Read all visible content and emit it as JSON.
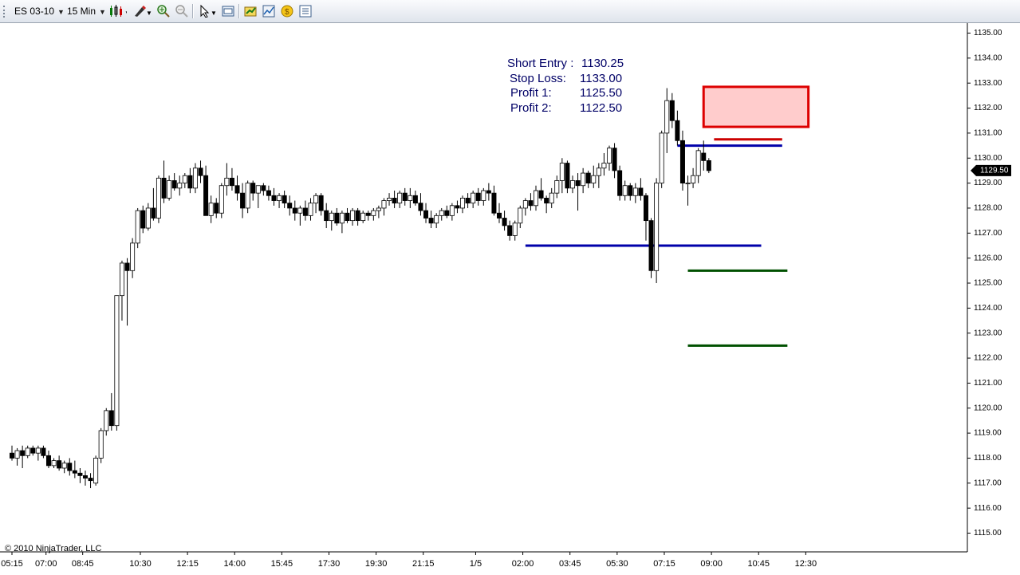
{
  "toolbar": {
    "instrument": "ES 03-10",
    "interval": "15 Min",
    "icons": [
      "bar-type-icon",
      "drawing-tool-icon",
      "zoom-in-icon",
      "zoom-out-icon",
      "pointer-icon",
      "data-box-icon",
      "strategy-icon",
      "indicator-icon",
      "alert-icon",
      "properties-icon"
    ]
  },
  "colors": {
    "entry_line": "#0000aa",
    "stop_line": "#cc0000",
    "target_line": "#005000",
    "stop_zone_fill": "#ffcccc",
    "stop_zone_border": "#dd0000",
    "text": "#000066"
  },
  "annotation": {
    "lines": [
      {
        "label": "Short Entry :",
        "value": "1130.25"
      },
      {
        "label": "Stop Loss:",
        "value": "1133.00"
      },
      {
        "label": "Profit 1:",
        "value": "1125.50"
      },
      {
        "label": "Profit 2:",
        "value": "1122.50"
      }
    ]
  },
  "copyright": "© 2010 NinjaTrader, LLC",
  "chart_data": {
    "type": "candlestick",
    "instrument": "ES 03-10",
    "interval": "15 Min",
    "ylim": [
      1114.5,
      1135.5
    ],
    "y_ticks": [
      "1115.00",
      "1116.00",
      "1117.00",
      "1118.00",
      "1119.00",
      "1120.00",
      "1121.00",
      "1122.00",
      "1123.00",
      "1124.00",
      "1125.00",
      "1126.00",
      "1127.00",
      "1128.00",
      "1129.00",
      "1130.00",
      "1131.00",
      "1132.00",
      "1133.00",
      "1134.00",
      "1135.00"
    ],
    "x_tick_labels": [
      "05:15",
      "07:00",
      "08:45",
      "10:30",
      "12:15",
      "14:00",
      "15:45",
      "17:30",
      "19:30",
      "21:15",
      "1/5",
      "02:00",
      "03:45",
      "05:30",
      "07:15",
      "09:00",
      "10:45",
      "12:30"
    ],
    "last_price_label": "1129.50",
    "last_price": 1129.5,
    "candles": [
      [
        1118.2,
        1118.5,
        1117.9,
        1118.0
      ],
      [
        1118.0,
        1118.4,
        1117.7,
        1118.3
      ],
      [
        1118.3,
        1118.5,
        1117.6,
        1118.1
      ],
      [
        1118.1,
        1118.5,
        1118.0,
        1118.4
      ],
      [
        1118.4,
        1118.5,
        1118.1,
        1118.2
      ],
      [
        1118.2,
        1118.5,
        1117.9,
        1118.4
      ],
      [
        1118.4,
        1118.5,
        1118.0,
        1118.1
      ],
      [
        1118.1,
        1118.3,
        1117.6,
        1117.7
      ],
      [
        1117.7,
        1118.0,
        1117.6,
        1117.9
      ],
      [
        1117.9,
        1118.1,
        1117.5,
        1117.6
      ],
      [
        1117.6,
        1117.9,
        1117.4,
        1117.8
      ],
      [
        1117.8,
        1118.0,
        1117.3,
        1117.5
      ],
      [
        1117.5,
        1117.9,
        1117.2,
        1117.4
      ],
      [
        1117.4,
        1117.6,
        1117.0,
        1117.3
      ],
      [
        1117.3,
        1117.5,
        1116.9,
        1117.2
      ],
      [
        1117.2,
        1117.4,
        1116.8,
        1117.1
      ],
      [
        1117.0,
        1118.1,
        1116.9,
        1118.0
      ],
      [
        1118.0,
        1119.2,
        1117.8,
        1119.1
      ],
      [
        1119.1,
        1120.0,
        1118.9,
        1119.9
      ],
      [
        1119.9,
        1120.6,
        1119.1,
        1119.3
      ],
      [
        1119.3,
        1124.5,
        1119.1,
        1124.5
      ],
      [
        1124.5,
        1125.9,
        1123.5,
        1125.8
      ],
      [
        1125.8,
        1126.0,
        1123.3,
        1125.5
      ],
      [
        1125.5,
        1126.8,
        1125.2,
        1126.6
      ],
      [
        1126.6,
        1128.0,
        1126.4,
        1127.9
      ],
      [
        1127.9,
        1128.1,
        1127.0,
        1127.2
      ],
      [
        1127.2,
        1128.2,
        1127.1,
        1128.0
      ],
      [
        1128.0,
        1128.8,
        1127.5,
        1127.6
      ],
      [
        1127.6,
        1129.3,
        1127.4,
        1129.2
      ],
      [
        1129.2,
        1129.9,
        1128.2,
        1128.4
      ],
      [
        1128.4,
        1129.3,
        1128.3,
        1129.1
      ],
      [
        1129.1,
        1129.4,
        1128.7,
        1128.8
      ],
      [
        1128.8,
        1129.3,
        1128.5,
        1129.0
      ],
      [
        1129.0,
        1129.4,
        1128.8,
        1129.3
      ],
      [
        1129.3,
        1129.6,
        1128.6,
        1128.8
      ],
      [
        1128.8,
        1129.8,
        1128.6,
        1129.6
      ],
      [
        1129.6,
        1129.9,
        1129.0,
        1129.3
      ],
      [
        1129.3,
        1129.7,
        1127.8,
        1127.7
      ],
      [
        1127.7,
        1128.5,
        1127.4,
        1128.2
      ],
      [
        1128.2,
        1128.4,
        1127.6,
        1127.8
      ],
      [
        1127.8,
        1129.0,
        1127.6,
        1128.9
      ],
      [
        1128.9,
        1129.8,
        1128.5,
        1129.2
      ],
      [
        1129.2,
        1129.6,
        1128.7,
        1128.9
      ],
      [
        1128.9,
        1129.3,
        1128.3,
        1128.6
      ],
      [
        1128.6,
        1129.0,
        1127.6,
        1128.0
      ],
      [
        1128.0,
        1129.1,
        1127.8,
        1129.0
      ],
      [
        1129.0,
        1129.1,
        1128.3,
        1128.6
      ],
      [
        1128.6,
        1128.9,
        1128.0,
        1128.9
      ],
      [
        1128.9,
        1129.0,
        1128.5,
        1128.7
      ],
      [
        1128.7,
        1128.9,
        1128.3,
        1128.5
      ],
      [
        1128.5,
        1128.8,
        1128.1,
        1128.3
      ],
      [
        1128.3,
        1128.6,
        1128.0,
        1128.5
      ],
      [
        1128.5,
        1128.7,
        1128.0,
        1128.2
      ],
      [
        1128.2,
        1128.5,
        1127.7,
        1128.0
      ],
      [
        1128.0,
        1128.3,
        1127.5,
        1127.8
      ],
      [
        1127.8,
        1128.1,
        1127.3,
        1128.0
      ],
      [
        1128.0,
        1128.3,
        1127.5,
        1127.7
      ],
      [
        1127.7,
        1128.4,
        1127.5,
        1128.2
      ],
      [
        1128.2,
        1128.6,
        1127.8,
        1128.5
      ],
      [
        1128.5,
        1128.6,
        1127.7,
        1127.9
      ],
      [
        1127.9,
        1128.2,
        1127.2,
        1127.5
      ],
      [
        1127.5,
        1127.9,
        1127.1,
        1127.8
      ],
      [
        1127.8,
        1128.0,
        1127.3,
        1127.4
      ],
      [
        1127.4,
        1127.9,
        1127.0,
        1127.8
      ],
      [
        1127.8,
        1128.0,
        1127.4,
        1127.5
      ],
      [
        1127.5,
        1128.0,
        1127.3,
        1127.9
      ],
      [
        1127.9,
        1128.0,
        1127.3,
        1127.5
      ],
      [
        1127.5,
        1127.9,
        1127.4,
        1127.8
      ],
      [
        1127.8,
        1127.9,
        1127.5,
        1127.7
      ],
      [
        1127.7,
        1128.0,
        1127.5,
        1127.9
      ],
      [
        1127.9,
        1128.1,
        1127.6,
        1128.0
      ],
      [
        1128.0,
        1128.4,
        1127.7,
        1128.3
      ],
      [
        1128.3,
        1128.6,
        1128.1,
        1128.4
      ],
      [
        1128.4,
        1128.7,
        1128.0,
        1128.2
      ],
      [
        1128.2,
        1128.7,
        1128.0,
        1128.6
      ],
      [
        1128.6,
        1128.8,
        1128.1,
        1128.3
      ],
      [
        1128.3,
        1128.8,
        1128.0,
        1128.5
      ],
      [
        1128.5,
        1128.7,
        1128.1,
        1128.2
      ],
      [
        1128.2,
        1128.6,
        1127.7,
        1127.9
      ],
      [
        1127.9,
        1128.2,
        1127.4,
        1127.6
      ],
      [
        1127.6,
        1127.9,
        1127.2,
        1127.4
      ],
      [
        1127.4,
        1127.8,
        1127.2,
        1127.7
      ],
      [
        1127.7,
        1128.0,
        1127.5,
        1127.9
      ],
      [
        1127.9,
        1128.1,
        1127.6,
        1127.7
      ],
      [
        1127.7,
        1128.2,
        1127.5,
        1128.1
      ],
      [
        1128.1,
        1128.3,
        1127.8,
        1128.0
      ],
      [
        1128.0,
        1128.5,
        1127.8,
        1128.4
      ],
      [
        1128.4,
        1128.6,
        1128.0,
        1128.2
      ],
      [
        1128.2,
        1128.7,
        1128.0,
        1128.6
      ],
      [
        1128.6,
        1128.8,
        1128.1,
        1128.3
      ],
      [
        1128.3,
        1128.8,
        1128.1,
        1128.7
      ],
      [
        1128.7,
        1129.0,
        1128.3,
        1128.6
      ],
      [
        1128.6,
        1128.9,
        1127.7,
        1127.8
      ],
      [
        1127.8,
        1128.2,
        1127.4,
        1127.6
      ],
      [
        1127.6,
        1127.9,
        1127.1,
        1127.3
      ],
      [
        1127.3,
        1127.5,
        1126.7,
        1126.9
      ],
      [
        1126.9,
        1127.5,
        1126.7,
        1127.4
      ],
      [
        1127.4,
        1128.1,
        1127.2,
        1128.0
      ],
      [
        1128.0,
        1128.4,
        1127.7,
        1128.3
      ],
      [
        1128.3,
        1128.6,
        1127.9,
        1128.1
      ],
      [
        1128.1,
        1128.9,
        1127.9,
        1128.7
      ],
      [
        1128.7,
        1129.2,
        1128.3,
        1128.4
      ],
      [
        1128.4,
        1128.5,
        1127.8,
        1128.2
      ],
      [
        1128.2,
        1128.8,
        1128.0,
        1128.6
      ],
      [
        1128.6,
        1129.3,
        1128.4,
        1129.1
      ],
      [
        1129.1,
        1130.0,
        1128.6,
        1129.8
      ],
      [
        1129.8,
        1129.9,
        1128.6,
        1128.8
      ],
      [
        1128.8,
        1129.3,
        1128.6,
        1129.1
      ],
      [
        1129.1,
        1129.4,
        1127.9,
        1128.9
      ],
      [
        1128.9,
        1129.6,
        1128.6,
        1129.4
      ],
      [
        1129.4,
        1129.5,
        1128.8,
        1129.0
      ],
      [
        1129.0,
        1129.7,
        1128.8,
        1129.3
      ],
      [
        1129.3,
        1129.8,
        1128.8,
        1129.6
      ],
      [
        1129.6,
        1130.2,
        1129.3,
        1129.8
      ],
      [
        1129.8,
        1130.5,
        1129.5,
        1130.4
      ],
      [
        1130.4,
        1130.6,
        1129.2,
        1129.5
      ],
      [
        1129.5,
        1129.7,
        1128.3,
        1128.5
      ],
      [
        1128.5,
        1129.1,
        1128.3,
        1128.9
      ],
      [
        1128.9,
        1129.0,
        1128.3,
        1128.5
      ],
      [
        1128.5,
        1129.0,
        1128.2,
        1128.8
      ],
      [
        1128.8,
        1129.2,
        1128.3,
        1128.5
      ],
      [
        1128.5,
        1128.6,
        1126.7,
        1127.5
      ],
      [
        1127.5,
        1127.6,
        1125.2,
        1125.5
      ],
      [
        1125.5,
        1129.2,
        1125.0,
        1129.0
      ],
      [
        1129.0,
        1131.1,
        1128.8,
        1131.0
      ],
      [
        1131.0,
        1132.8,
        1130.2,
        1132.3
      ],
      [
        1132.3,
        1132.6,
        1131.2,
        1131.5
      ],
      [
        1131.5,
        1131.9,
        1130.5,
        1130.7
      ],
      [
        1130.7,
        1131.1,
        1128.7,
        1129.0
      ],
      [
        1129.0,
        1129.3,
        1128.1,
        1129.0
      ],
      [
        1129.0,
        1129.6,
        1128.8,
        1129.3
      ],
      [
        1129.3,
        1130.4,
        1129.0,
        1130.3
      ],
      [
        1130.2,
        1130.7,
        1129.5,
        1129.9
      ],
      [
        1129.9,
        1130.0,
        1129.4,
        1129.5
      ]
    ],
    "levels": [
      {
        "name": "entry-short",
        "price": 1130.5,
        "from": 127,
        "to": 147
      },
      {
        "name": "support",
        "price": 1126.5,
        "from": 98,
        "to": 143
      },
      {
        "name": "stop",
        "price": 1130.75,
        "from": 134,
        "to": 147
      },
      {
        "name": "profit-1",
        "price": 1125.5,
        "from": 129,
        "to": 148
      },
      {
        "name": "profit-2",
        "price": 1122.5,
        "from": 129,
        "to": 148
      },
      {
        "name": "stop-zone",
        "price_low": 1131.25,
        "price_high": 1132.85,
        "from": 132,
        "to": 152
      }
    ]
  }
}
